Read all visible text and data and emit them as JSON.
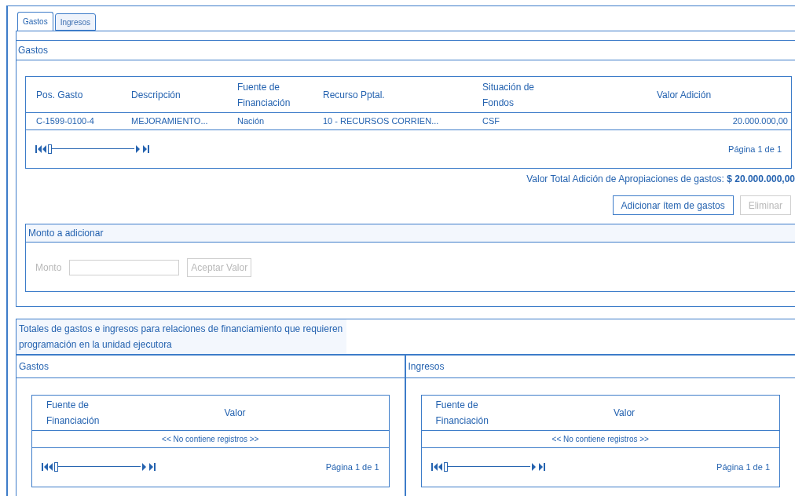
{
  "tabs": [
    {
      "label": "Gastos",
      "selected": true
    },
    {
      "label": "Ingresos",
      "selected": false
    }
  ],
  "gastos_panel": {
    "title": "Gastos",
    "table": {
      "columns": [
        "Pos. Gasto",
        "Descripción",
        "Fuente de Financiación",
        "Recurso Pptal.",
        "Situación de Fondos",
        "Valor Adición"
      ],
      "rows": [
        [
          "C-1599-0100-4",
          "MEJORAMIENTO...",
          "Nación",
          "10 - RECURSOS CORRIEN...",
          "CSF",
          "20.000.000,00"
        ]
      ],
      "pager": {
        "level": 0,
        "page": "Página 1 de 1"
      }
    },
    "total_label": "Valor Total Adición de Apropiaciones de gastos:",
    "total_value": "$ 20.000.000,00",
    "buttons": [
      {
        "label": "Adicionar ítem de gastos",
        "disabled": false
      },
      {
        "label": "Eliminar",
        "disabled": true
      }
    ],
    "monto_panel": {
      "title": "Monto a adicionar",
      "label": "Monto",
      "disabled": true,
      "button": "Aceptar Valor"
    }
  },
  "totales": {
    "title": "Totales de gastos e ingresos para relaciones de financiamiento que requieren programación en la unidad ejecutora",
    "sections": [
      {
        "title": "Gastos",
        "columns": [
          "Fuente de Financiación",
          "Valor"
        ],
        "empty": "<< No contiene registros >>",
        "pager": {
          "level": 0,
          "page": "Página 1 de 1"
        }
      },
      {
        "title": "Ingresos",
        "columns": [
          "Fuente de Financiación",
          "Valor"
        ],
        "empty": "<< No contiene registros >>",
        "pager": {
          "level": 0,
          "page": "Página 1 de 1"
        }
      }
    ]
  }
}
